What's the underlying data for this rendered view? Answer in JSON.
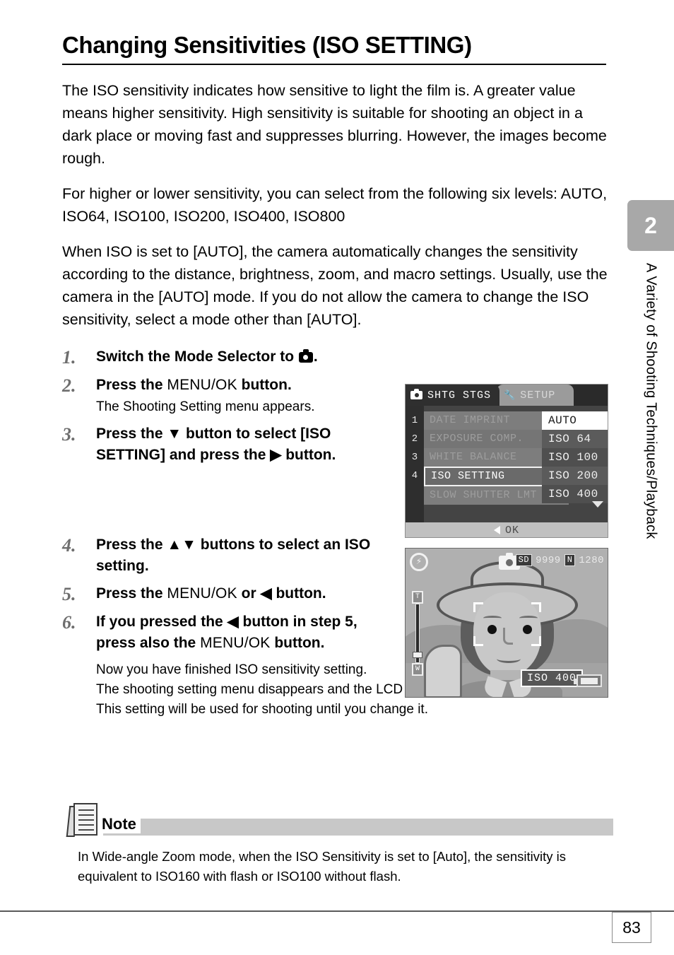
{
  "document": {
    "title": "Changing Sensitivities (ISO SETTING)",
    "page_number": "83"
  },
  "intro": {
    "paragraph1": "The ISO sensitivity indicates how sensitive to light the film is. A greater value means higher sensitivity. High sensitivity is suitable for shooting an object in a dark place or moving fast and suppresses blurring. However, the images become rough.",
    "paragraph2": "For higher or lower sensitivity, you can select from the following six levels: AUTO, ISO64, ISO100, ISO200, ISO400, ISO800",
    "paragraph3": "When ISO is set to [AUTO], the camera automatically changes the sensitivity according to the distance, brightness, zoom, and macro settings. Usually, use the camera in the [AUTO] mode. If you do not allow the camera to change the ISO sensitivity, select a mode other than [AUTO]."
  },
  "steps": [
    {
      "num": "1.",
      "head_a": "Switch the Mode Selector to ",
      "head_b": ".",
      "sub": ""
    },
    {
      "num": "2.",
      "head_a": "Press the ",
      "head_mid": "MENU/OK",
      "head_b": " button.",
      "sub": "The Shooting Setting menu appears."
    },
    {
      "num": "3.",
      "head_a": "Press the ▼ button to select [ISO SETTING] and press the ▶ button.",
      "sub": ""
    },
    {
      "num": "4.",
      "head_a": "Press the ▲▼ buttons to select an ISO setting.",
      "sub": ""
    },
    {
      "num": "5.",
      "head_a": "Press the ",
      "head_mid": "MENU/OK",
      "head_b": " or ◀ button.",
      "sub": ""
    },
    {
      "num": "6.",
      "head_a": "If you pressed the ◀ button in step 5, press also the ",
      "head_mid": "MENU/OK",
      "head_b": " button.",
      "sub": ""
    }
  ],
  "tail": {
    "line1": "Now you have finished ISO sensitivity setting.",
    "line2": "The shooting setting menu disappears and the LCD monitor displays the set values.",
    "line3": "This setting will be used for shooting until you change it."
  },
  "lcd_menu": {
    "tab_shooting": "SHTG STGS",
    "tab_setup": "SETUP",
    "row_numbers": [
      "1",
      "2",
      "3",
      "4"
    ],
    "highlighted_row_number": "3",
    "items": [
      {
        "label": "DATE IMPRINT",
        "selected": false
      },
      {
        "label": "EXPOSURE COMP.",
        "selected": false
      },
      {
        "label": "WHITE BALANCE",
        "selected": false
      },
      {
        "label": "ISO SETTING",
        "selected": true
      },
      {
        "label": "SLOW SHUTTER LMT",
        "selected": false
      }
    ],
    "iso_options": [
      {
        "label": "AUTO",
        "selected": true
      },
      {
        "label": "ISO 64",
        "selected": false
      },
      {
        "label": "ISO 100",
        "selected": false
      },
      {
        "label": "ISO 200",
        "selected": false
      },
      {
        "label": "ISO 400",
        "selected": false
      }
    ],
    "footer_label": "OK"
  },
  "lcd_view": {
    "card_chip": "SD",
    "shots_remaining": "9999",
    "quality_chip": "N",
    "resolution": "1280",
    "iso_badge": "ISO 400",
    "zoom_top_label": "T",
    "zoom_bottom_label": "W"
  },
  "note": {
    "label": "Note",
    "text": "In Wide-angle Zoom mode, when the ISO Sensitivity is set to [Auto], the sensitivity is equivalent to ISO160 with flash or ISO100 without flash."
  },
  "sidebar": {
    "chapter": "2",
    "chapter_title": "A Variety of Shooting Techniques/Playback"
  }
}
